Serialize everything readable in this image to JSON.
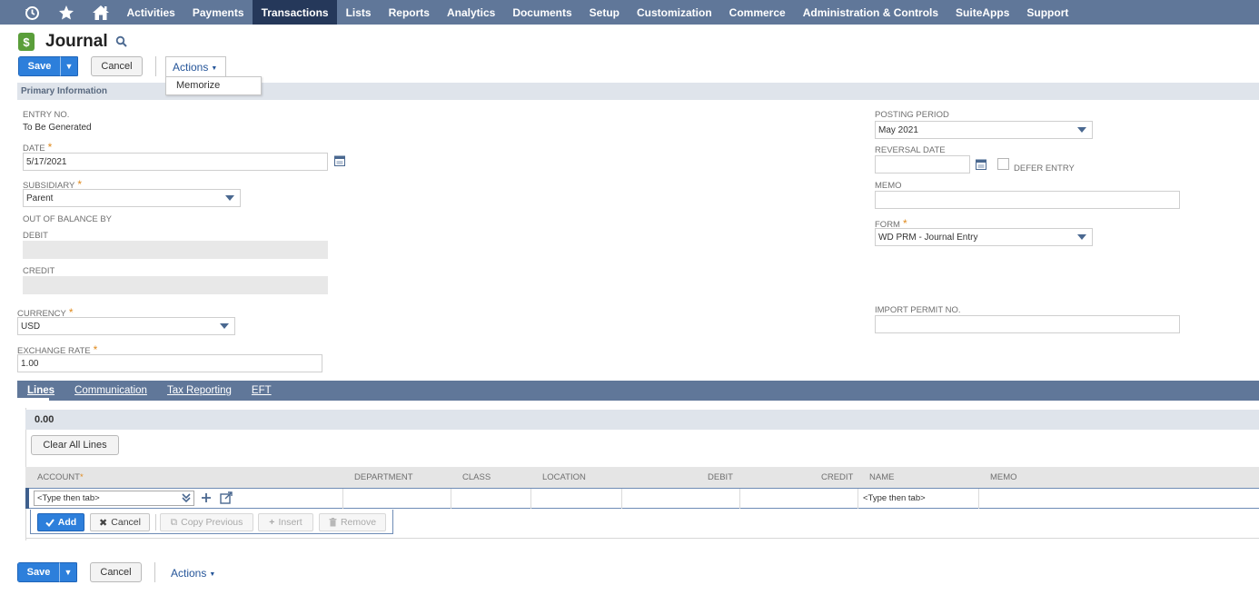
{
  "nav": {
    "items": [
      "Activities",
      "Payments",
      "Transactions",
      "Lists",
      "Reports",
      "Analytics",
      "Documents",
      "Setup",
      "Customization",
      "Commerce",
      "Administration & Controls",
      "SuiteApps",
      "Support"
    ],
    "active": "Transactions",
    "icons": [
      "recent-icon",
      "star-icon",
      "home-icon"
    ]
  },
  "page": {
    "title": "Journal",
    "title_icon": "$"
  },
  "toolbar": {
    "save_label": "Save",
    "cancel_label": "Cancel",
    "actions_label": "Actions",
    "actions_menu": [
      "Memorize"
    ]
  },
  "section": {
    "primary_title": "Primary Information"
  },
  "fields": {
    "entry_no": {
      "label": "Entry No.",
      "value": "To Be Generated"
    },
    "date": {
      "label": "Date",
      "value": "5/17/2021"
    },
    "subsidiary": {
      "label": "Subsidiary",
      "value": "Parent"
    },
    "out_of_balance": {
      "label": "Out of Balance By"
    },
    "debit": {
      "label": "Debit",
      "value": ""
    },
    "credit": {
      "label": "Credit",
      "value": ""
    },
    "currency": {
      "label": "Currency",
      "value": "USD"
    },
    "exchange_rate": {
      "label": "Exchange Rate",
      "value": "1.00"
    },
    "posting_period": {
      "label": "Posting Period",
      "value": "May 2021"
    },
    "reversal_date": {
      "label": "Reversal Date",
      "value": ""
    },
    "defer_entry": {
      "label": "Defer Entry",
      "checked": false
    },
    "memo": {
      "label": "Memo",
      "value": ""
    },
    "form": {
      "label": "Form",
      "value": "WD PRM - Journal Entry"
    },
    "import_permit": {
      "label": "Import Permit No.",
      "value": ""
    }
  },
  "subtabs": [
    "Lines",
    "Communication",
    "Tax Reporting",
    "EFT"
  ],
  "lines": {
    "total": "0.00",
    "clear_all_label": "Clear All Lines",
    "columns": [
      "Account",
      "Department",
      "Class",
      "Location",
      "Debit",
      "Credit",
      "Name",
      "Memo"
    ],
    "account_placeholder": "<Type then tab>",
    "name_placeholder": "<Type then tab>",
    "row_buttons": {
      "add": "Add",
      "cancel": "Cancel",
      "copy_previous": "Copy Previous",
      "insert": "Insert",
      "remove": "Remove"
    }
  },
  "colors": {
    "nav_bg": "#607799",
    "nav_active": "#25385a",
    "primary_button": "#2d7fdb",
    "required": "#e08a1e",
    "section_bg": "#dfe4eb"
  }
}
